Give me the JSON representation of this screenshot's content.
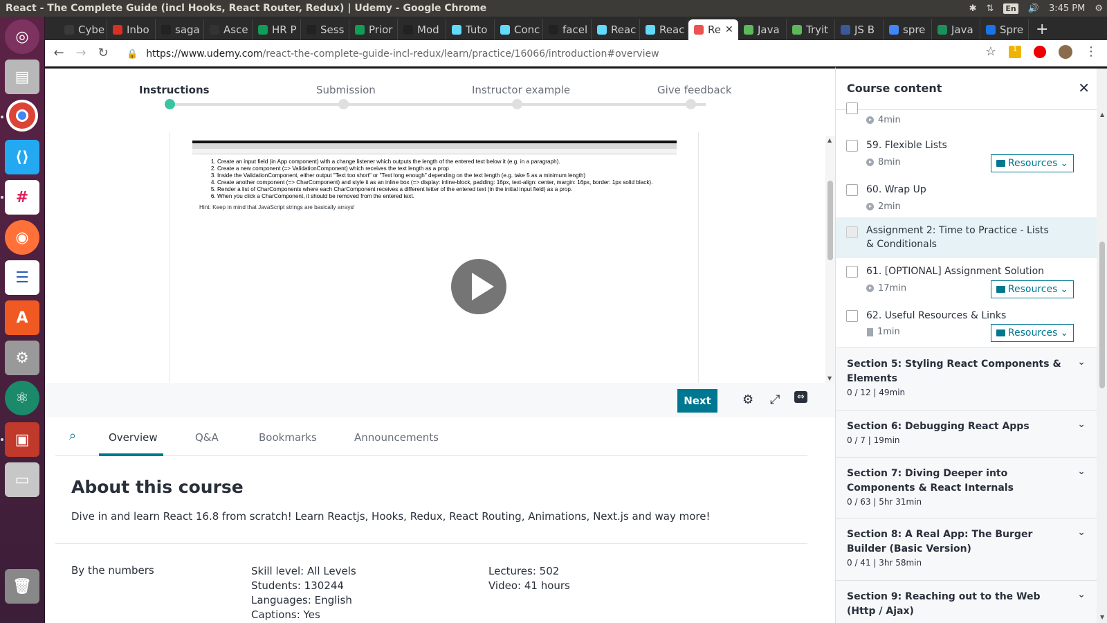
{
  "os": {
    "window_title": "React - The Complete Guide (incl Hooks, React Router, Redux) | Udemy - Google Chrome",
    "time": "3:45 PM",
    "lang": "En"
  },
  "browser": {
    "tabs": [
      {
        "label": "Cybe",
        "color": "#3a3a3a"
      },
      {
        "label": "Inbo",
        "color": "#d93025"
      },
      {
        "label": "saga",
        "color": "#222222"
      },
      {
        "label": "Asce",
        "color": "#333333"
      },
      {
        "label": "HR P",
        "color": "#0f9d58"
      },
      {
        "label": "Sess",
        "color": "#222222"
      },
      {
        "label": "Prior",
        "color": "#0f9d58"
      },
      {
        "label": "Mod",
        "color": "#222222"
      },
      {
        "label": "Tuto",
        "color": "#61dafb"
      },
      {
        "label": "Conc",
        "color": "#61dafb"
      },
      {
        "label": "facel",
        "color": "#222222"
      },
      {
        "label": "Reac",
        "color": "#61dafb"
      },
      {
        "label": "Reac",
        "color": "#61dafb"
      },
      {
        "label": "Re",
        "color": "#ec5252",
        "active": true
      },
      {
        "label": "Java",
        "color": "#5cb85c"
      },
      {
        "label": "Tryit",
        "color": "#5cb85c"
      },
      {
        "label": "JS B",
        "color": "#3b5998"
      },
      {
        "label": "spre",
        "color": "#4285f4"
      },
      {
        "label": "Java",
        "color": "#1d8f5a"
      },
      {
        "label": "Spre",
        "color": "#1a73e8"
      }
    ],
    "url_host": "https://www.udemy.com",
    "url_path": "/react-the-complete-guide-incl-redux/learn/practice/16066/introduction#overview"
  },
  "steps": {
    "labels": [
      "Instructions",
      "Submission",
      "Instructor example",
      "Give feedback"
    ],
    "active_index": 0
  },
  "video": {
    "instructions": [
      "Create an input field (in App component) with a change listener which outputs the length of the entered text below it (e.g. in a paragraph).",
      "Create a new component (=> ValidationComponent) which receives the text length as a prop",
      "Inside the ValidationComponent, either output \"Text too short\" or \"Text long enough\" depending on the text length (e.g. take 5 as a minimum length)",
      "Create another component (=> CharComponent) and style it as an inline box (=> display: inline-block, padding: 16px, text-align: center, margin: 16px, border: 1px solid black).",
      "Render a list of CharComponents where each CharComponent receives a different letter of the entered text (in the initial input field) as a prop.",
      "When you click a CharComponent, it should be removed from the entered text."
    ],
    "hint": "Hint: Keep in mind that JavaScript strings are basically arrays!"
  },
  "controls": {
    "next_label": "Next"
  },
  "panel_tabs": [
    "Overview",
    "Q&A",
    "Bookmarks",
    "Announcements"
  ],
  "about": {
    "title": "About this course",
    "description": "Dive in and learn React 16.8 from scratch! Learn Reactjs, Hooks, Redux, React Routing, Animations, Next.js and way more!",
    "numbers_label": "By the numbers",
    "col1": [
      "Skill level: All Levels",
      "Students: 130244",
      "Languages: English",
      "Captions: Yes"
    ],
    "col2": [
      "Lectures: 502",
      "Video: 41 hours"
    ]
  },
  "sidebar": {
    "title": "Course content",
    "top_meta": "4min",
    "lectures": [
      {
        "title": "59. Flexible Lists",
        "meta": "8min",
        "resources": true
      },
      {
        "title": "60. Wrap Up",
        "meta": "2min",
        "resources": false
      },
      {
        "title": "Assignment 2: Time to Practice - Lists & Conditionals",
        "meta": "",
        "resources": false
      },
      {
        "title": "61. [OPTIONAL] Assignment Solution",
        "meta": "17min",
        "resources": true
      },
      {
        "title": "62. Useful Resources & Links",
        "meta": "1min",
        "resources": true
      }
    ],
    "resources_label": "Resources",
    "sections": [
      {
        "title": "Section 5: Styling React Components & Elements",
        "meta": "0 / 12 | 49min"
      },
      {
        "title": "Section 6: Debugging React Apps",
        "meta": "0 / 7 | 19min"
      },
      {
        "title": "Section 7: Diving Deeper into Components & React Internals",
        "meta": "0 / 63 | 5hr 31min"
      },
      {
        "title": "Section 8: A Real App: The Burger Builder (Basic Version)",
        "meta": "0 / 41 | 3hr 58min"
      },
      {
        "title": "Section 9: Reaching out to the Web (Http / Ajax)",
        "meta": ""
      }
    ]
  }
}
